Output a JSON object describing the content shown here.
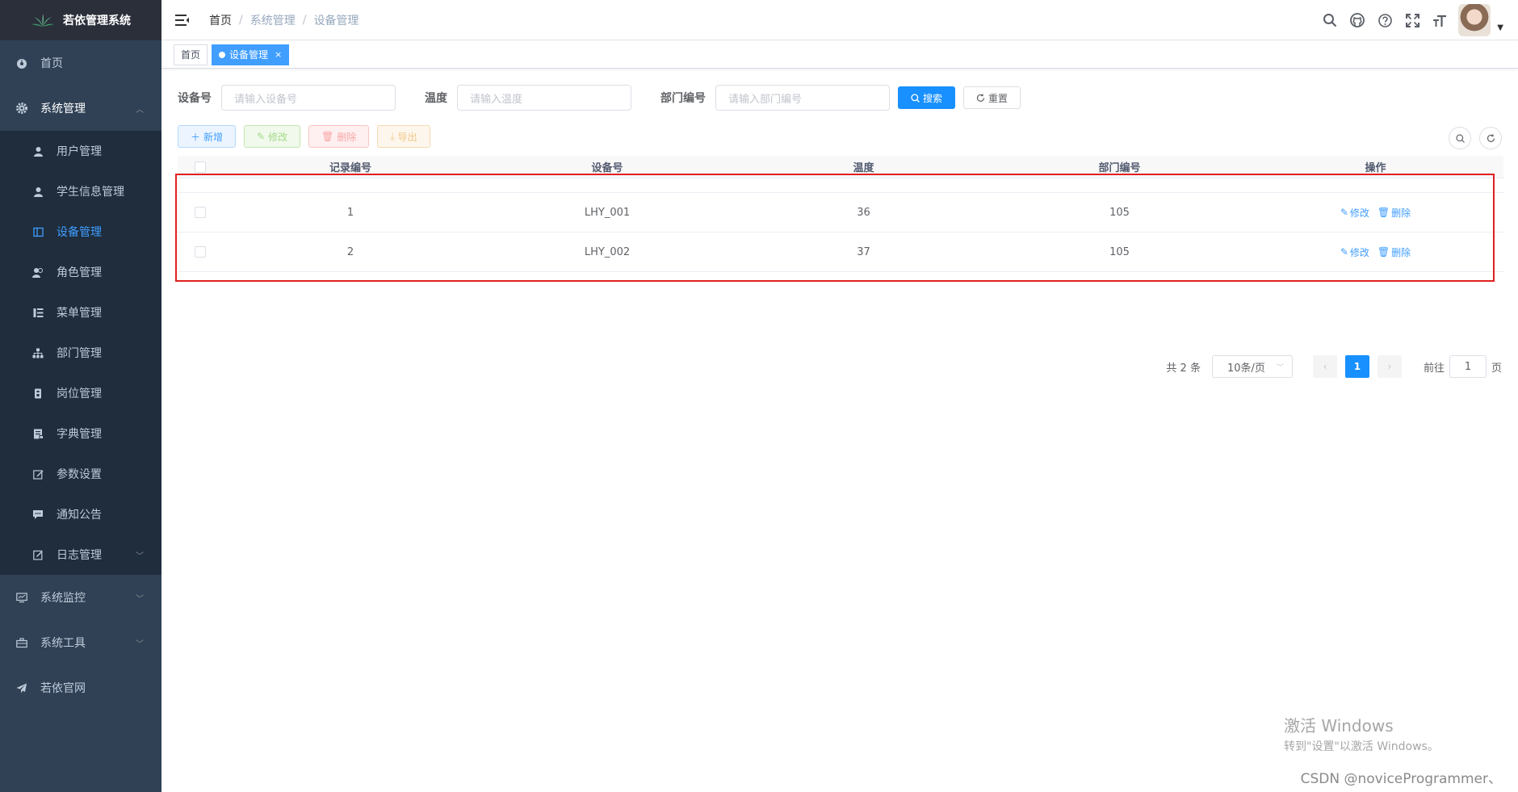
{
  "app": {
    "title": "若依管理系统"
  },
  "sidebar": {
    "items": [
      {
        "label": "首页",
        "icon": "dashboard-icon"
      },
      {
        "label": "系统管理",
        "icon": "gear-icon",
        "expanded": true
      },
      {
        "label": "系统监控",
        "icon": "monitor-icon"
      },
      {
        "label": "系统工具",
        "icon": "toolbox-icon"
      },
      {
        "label": "若依官网",
        "icon": "send-icon"
      }
    ],
    "sub_items": [
      {
        "label": "用户管理",
        "icon": "user-icon"
      },
      {
        "label": "学生信息管理",
        "icon": "user-icon"
      },
      {
        "label": "设备管理",
        "icon": "table-icon",
        "active": true
      },
      {
        "label": "角色管理",
        "icon": "peoples-icon"
      },
      {
        "label": "菜单管理",
        "icon": "tree-table-icon"
      },
      {
        "label": "部门管理",
        "icon": "tree-icon"
      },
      {
        "label": "岗位管理",
        "icon": "post-icon"
      },
      {
        "label": "字典管理",
        "icon": "dict-icon"
      },
      {
        "label": "参数设置",
        "icon": "edit-icon"
      },
      {
        "label": "通知公告",
        "icon": "message-icon"
      },
      {
        "label": "日志管理",
        "icon": "log-icon"
      }
    ]
  },
  "navbar": {
    "breadcrumb": [
      "首页",
      "系统管理",
      "设备管理"
    ]
  },
  "tags": [
    {
      "label": "首页",
      "active": false
    },
    {
      "label": "设备管理",
      "active": true,
      "close": "×"
    }
  ],
  "search": {
    "fields": [
      {
        "label": "设备号",
        "placeholder": "请输入设备号"
      },
      {
        "label": "温度",
        "placeholder": "请输入温度"
      },
      {
        "label": "部门编号",
        "placeholder": "请输入部门编号"
      }
    ],
    "search_label": "搜索",
    "reset_label": "重置"
  },
  "toolbar": {
    "add_label": "新增",
    "edit_label": "修改",
    "delete_label": "删除",
    "export_label": "导出"
  },
  "table": {
    "headers": [
      "记录编号",
      "设备号",
      "温度",
      "部门编号",
      "操作"
    ],
    "rows": [
      {
        "id": "1",
        "device": "LHY_001",
        "temp": "36",
        "dept": "105"
      },
      {
        "id": "2",
        "device": "LHY_002",
        "temp": "37",
        "dept": "105"
      }
    ],
    "op_edit": "修改",
    "op_delete": "删除"
  },
  "pagination": {
    "total": "共 2 条",
    "page_size": "10条/页",
    "current": "1",
    "goto_prefix": "前往",
    "goto_value": "1",
    "goto_suffix": "页"
  },
  "watermark": {
    "activate_title": "激活 Windows",
    "activate_sub": "转到\"设置\"以激活 Windows。",
    "csdn": "CSDN @noviceProgrammer、"
  },
  "colors": {
    "sidebar_bg": "#304156",
    "primary": "#1890ff",
    "highlight": "#e02020"
  }
}
